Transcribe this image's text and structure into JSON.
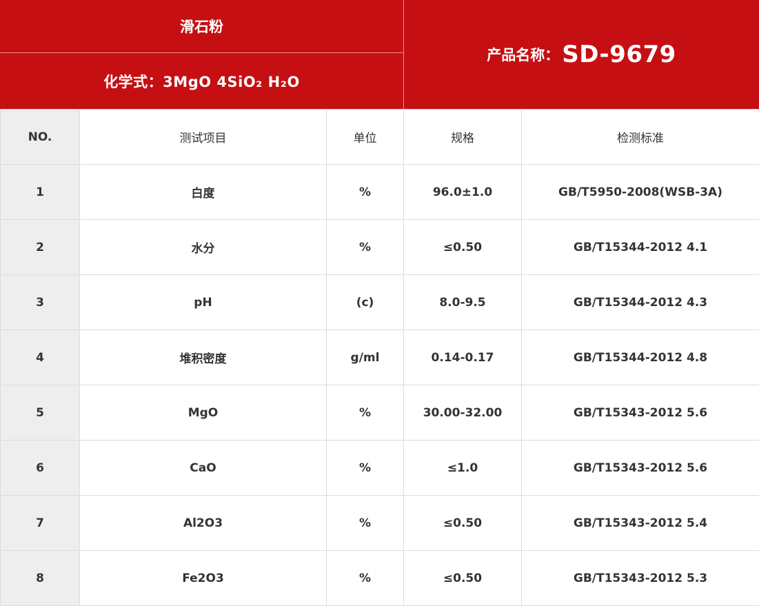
{
  "header": {
    "material": "滑石粉",
    "formula": "化学式：3MgO  4SiO₂  H₂O",
    "product_label": "产品名称：",
    "product_code": "SD-9679"
  },
  "columns": [
    "NO.",
    "测试项目",
    "单位",
    "规格",
    "检测标准"
  ],
  "rows": [
    {
      "no": "1",
      "item": "白度",
      "unit": "%",
      "spec": "96.0±1.0",
      "standard": "GB/T5950-2008(WSB-3A)"
    },
    {
      "no": "2",
      "item": "水分",
      "unit": "%",
      "spec": "≤0.50",
      "standard": "GB/T15344-2012 4.1"
    },
    {
      "no": "3",
      "item": "pH",
      "unit": "(c)",
      "spec": "8.0-9.5",
      "standard": "GB/T15344-2012 4.3"
    },
    {
      "no": "4",
      "item": "堆积密度",
      "unit": "g/ml",
      "spec": "0.14-0.17",
      "standard": "GB/T15344-2012 4.8"
    },
    {
      "no": "5",
      "item": "MgO",
      "unit": "%",
      "spec": "30.00-32.00",
      "standard": "GB/T15343-2012 5.6"
    },
    {
      "no": "6",
      "item": "CaO",
      "unit": "%",
      "spec": "≤1.0",
      "standard": "GB/T15343-2012 5.6"
    },
    {
      "no": "7",
      "item": "Al2O3",
      "unit": "%",
      "spec": "≤0.50",
      "standard": "GB/T15343-2012 5.4"
    },
    {
      "no": "8",
      "item": "Fe2O3",
      "unit": "%",
      "spec": "≤0.50",
      "standard": "GB/T15343-2012 5.3"
    }
  ],
  "colors": {
    "header_bg": "#c60f13",
    "no_col_bg": "#eeeeee",
    "border": "#dcdcdc"
  }
}
